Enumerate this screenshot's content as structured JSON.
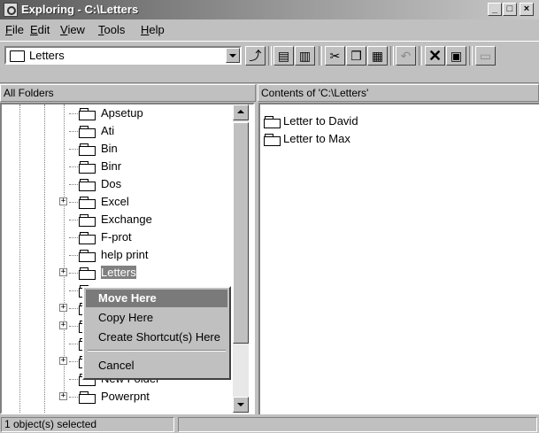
{
  "window": {
    "title": "Exploring - C:\\Letters",
    "min_label": "_",
    "max_label": "□",
    "close_label": "×"
  },
  "menu": [
    {
      "key": "F",
      "rest": "ile"
    },
    {
      "key": "E",
      "rest": "dit"
    },
    {
      "key": "V",
      "rest": "iew"
    },
    {
      "key": "T",
      "rest": "ools"
    },
    {
      "key": "H",
      "rest": "elp"
    }
  ],
  "toolbar": {
    "address_value": "Letters"
  },
  "panes": {
    "left_header": "All Folders",
    "right_header": "Contents of 'C:\\Letters'"
  },
  "tree": [
    {
      "label": "Apsetup",
      "expander": ""
    },
    {
      "label": "Ati",
      "expander": ""
    },
    {
      "label": "Bin",
      "expander": ""
    },
    {
      "label": "Binr",
      "expander": ""
    },
    {
      "label": "Dos",
      "expander": ""
    },
    {
      "label": "Excel",
      "expander": "+"
    },
    {
      "label": "Exchange",
      "expander": ""
    },
    {
      "label": "F-prot",
      "expander": ""
    },
    {
      "label": "help print",
      "expander": ""
    },
    {
      "label": "Letters",
      "expander": "+"
    },
    {
      "label": "",
      "expander": ""
    },
    {
      "label": "",
      "expander": "+"
    },
    {
      "label": "",
      "expander": "+"
    },
    {
      "label": "",
      "expander": ""
    },
    {
      "label": "",
      "expander": "+"
    },
    {
      "label": "New Folder",
      "expander": ""
    },
    {
      "label": "Powerpnt",
      "expander": "+"
    }
  ],
  "context_menu": {
    "move_here": "Move Here",
    "copy_here": "Copy Here",
    "create_shortcut": "Create Shortcut(s) Here",
    "cancel": "Cancel"
  },
  "files": [
    {
      "name": "Letter to David"
    },
    {
      "name": "Letter to Max"
    }
  ],
  "status": {
    "selected_text": "1 object(s) selected"
  }
}
